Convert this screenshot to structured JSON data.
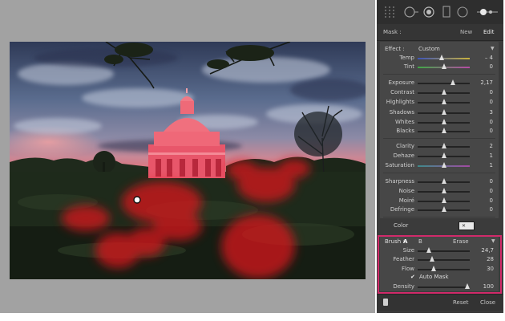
{
  "panel": {
    "mask_label": "Mask :",
    "mask_new": "New",
    "mask_edit": "Edit",
    "tools": [
      {
        "icon": "grid-overlay-icon"
      },
      {
        "icon": "crop-overlay-icon"
      },
      {
        "icon": "spot-removal-icon"
      },
      {
        "icon": "red-eye-icon"
      },
      {
        "icon": "graduated-filter-icon"
      },
      {
        "icon": "radial-filter-icon"
      },
      {
        "icon": "adjustment-brush-icon"
      }
    ]
  },
  "effect": {
    "label": "Effect :",
    "preset": "Custom",
    "sliders": [
      {
        "label": "Temp",
        "value": "– 4",
        "level": 0.46
      },
      {
        "label": "Tint",
        "value": "0",
        "level": 0.5
      },
      {
        "label": "Exposure",
        "value": "2,17",
        "level": 0.68
      },
      {
        "label": "Contrast",
        "value": "0",
        "level": 0.5
      },
      {
        "label": "Highlights",
        "value": "0",
        "level": 0.5
      },
      {
        "label": "Shadows",
        "value": "3",
        "level": 0.51
      },
      {
        "label": "Whites",
        "value": "0",
        "level": 0.5
      },
      {
        "label": "Blacks",
        "value": "0",
        "level": 0.5
      },
      {
        "label": "Clarity",
        "value": "2",
        "level": 0.51
      },
      {
        "label": "Dehaze",
        "value": "1",
        "level": 0.505
      },
      {
        "label": "Saturation",
        "value": "1",
        "level": 0.505
      },
      {
        "label": "Sharpness",
        "value": "0",
        "level": 0.5
      },
      {
        "label": "Noise",
        "value": "0",
        "level": 0.5
      },
      {
        "label": "Moiré",
        "value": "0",
        "level": 0.5
      },
      {
        "label": "Defringe",
        "value": "0",
        "level": 0.5
      }
    ],
    "color_label": "Color",
    "color_swatch_glyph": "✕"
  },
  "brush": {
    "label": "Brush :",
    "tab_a": "A",
    "tab_b": "B",
    "tab_erase": "Erase",
    "sliders": [
      {
        "label": "Size",
        "value": "24,7",
        "level": 0.22
      },
      {
        "label": "Feather",
        "value": "28",
        "level": 0.28
      },
      {
        "label": "Flow",
        "value": "30",
        "level": 0.3
      }
    ],
    "auto_mask_label": "Auto Mask",
    "auto_mask_checked": true,
    "auto_mask_glyph": "✔",
    "density_label": "Density",
    "density_value": "100",
    "density_level": 1.0,
    "highlight_color": "#d12a6a"
  },
  "footer": {
    "reset": "Reset",
    "close": "Close"
  },
  "colors": {
    "mask_overlay": "#e0141a",
    "sky_dark": "#3b4a68",
    "sunset": "#e0707a"
  }
}
